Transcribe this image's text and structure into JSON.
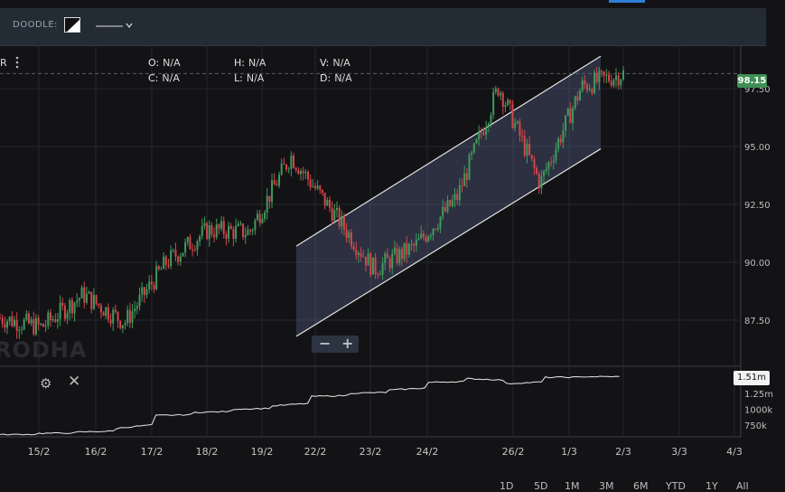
{
  "toolbar": {
    "doodle_label": "DOODLE:"
  },
  "header": {
    "left_letter": "R"
  },
  "ohlc": {
    "o_label": "O:",
    "o_value": "N/A",
    "h_label": "H:",
    "h_value": "N/A",
    "v_label": "V:",
    "v_value": "N/A",
    "c_label": "C:",
    "c_value": "N/A",
    "l_label": "L:",
    "l_value": "N/A",
    "d_label": "D:",
    "d_value": "N/A"
  },
  "watermark": "RODHA",
  "zoom": {
    "minus": "−",
    "plus": "+"
  },
  "price_badge": "98.15",
  "volume_badge": "1.51m",
  "timeframes": [
    "1D",
    "5D",
    "1M",
    "3M",
    "6M",
    "YTD",
    "1Y",
    "All"
  ],
  "colors": {
    "up": "#3f9a5c",
    "down": "#d2464a",
    "channel": "#9aa6d8",
    "grid": "#23272d",
    "price_line": "#56606a"
  },
  "chart_data": [
    {
      "type": "candlestick",
      "y_ticks": [
        "97.50",
        "95.00",
        "92.50",
        "90.00",
        "87.50"
      ],
      "y_tick_values": [
        97.5,
        95.0,
        92.5,
        90.0,
        87.5
      ],
      "ylim": [
        86.6,
        99.8
      ],
      "x_ticks": [
        "15/2",
        "16/2",
        "17/2",
        "18/2",
        "19/2",
        "22/2",
        "23/2",
        "24/2",
        "26/2",
        "1/3",
        "2/3",
        "3/3",
        "4/3"
      ],
      "last_price": 98.15,
      "grid": true,
      "session_closes": [
        87.6,
        87.2,
        88.6,
        87.4,
        90.0,
        91.4,
        91.3,
        94.6,
        92.2,
        89.7,
        90.7,
        92.8,
        97.6,
        93.4,
        97.6,
        98.15
      ],
      "channel": {
        "lower_start": 86.8,
        "lower_end": 94.9,
        "upper_start": 90.7,
        "upper_end": 98.9
      }
    },
    {
      "type": "line",
      "name": "volume",
      "y_ticks": [
        "1.51m",
        "1.25m",
        "1000k",
        "750k"
      ],
      "values_k": [
        600,
        620,
        640,
        700,
        900,
        950,
        1000,
        1050,
        1200,
        1250,
        1300,
        1420,
        1480,
        1400,
        1500,
        1510
      ]
    }
  ]
}
